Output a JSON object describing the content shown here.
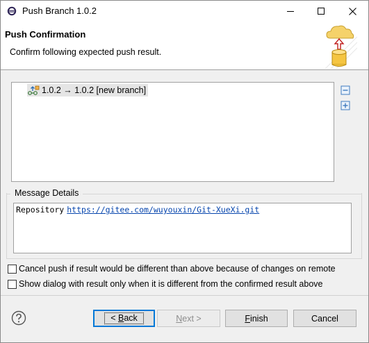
{
  "window": {
    "title": "Push Branch 1.0.2",
    "icon": "eclipse-icon"
  },
  "banner": {
    "title": "Push Confirmation",
    "subtitle": "Confirm following expected push result.",
    "image": "cloud-upload-database-icon"
  },
  "tree": {
    "items": [
      {
        "label": "1.0.2 → 1.0.2 [new branch]",
        "icon": "branch-push-icon"
      }
    ],
    "collapse_all_icon": "collapse-all-icon",
    "expand_all_icon": "expand-all-icon"
  },
  "message_details": {
    "label": "Message Details",
    "repository_label": "Repository",
    "repository_url": "https://gitee.com/wuyouxin/Git-XueXi.git"
  },
  "options": [
    {
      "label": "Cancel push if result would be different than above because of changes on remote",
      "checked": false
    },
    {
      "label": "Show dialog with result only when it is different from the confirmed result above",
      "checked": false
    }
  ],
  "footer": {
    "help_icon": "help-icon",
    "back_prefix": "< ",
    "back_mnemonic": "B",
    "back_rest": "ack",
    "next_mnemonic": "N",
    "next_rest": "ext >",
    "finish_mnemonic": "F",
    "finish_rest": "inish",
    "cancel_label": "Cancel"
  }
}
